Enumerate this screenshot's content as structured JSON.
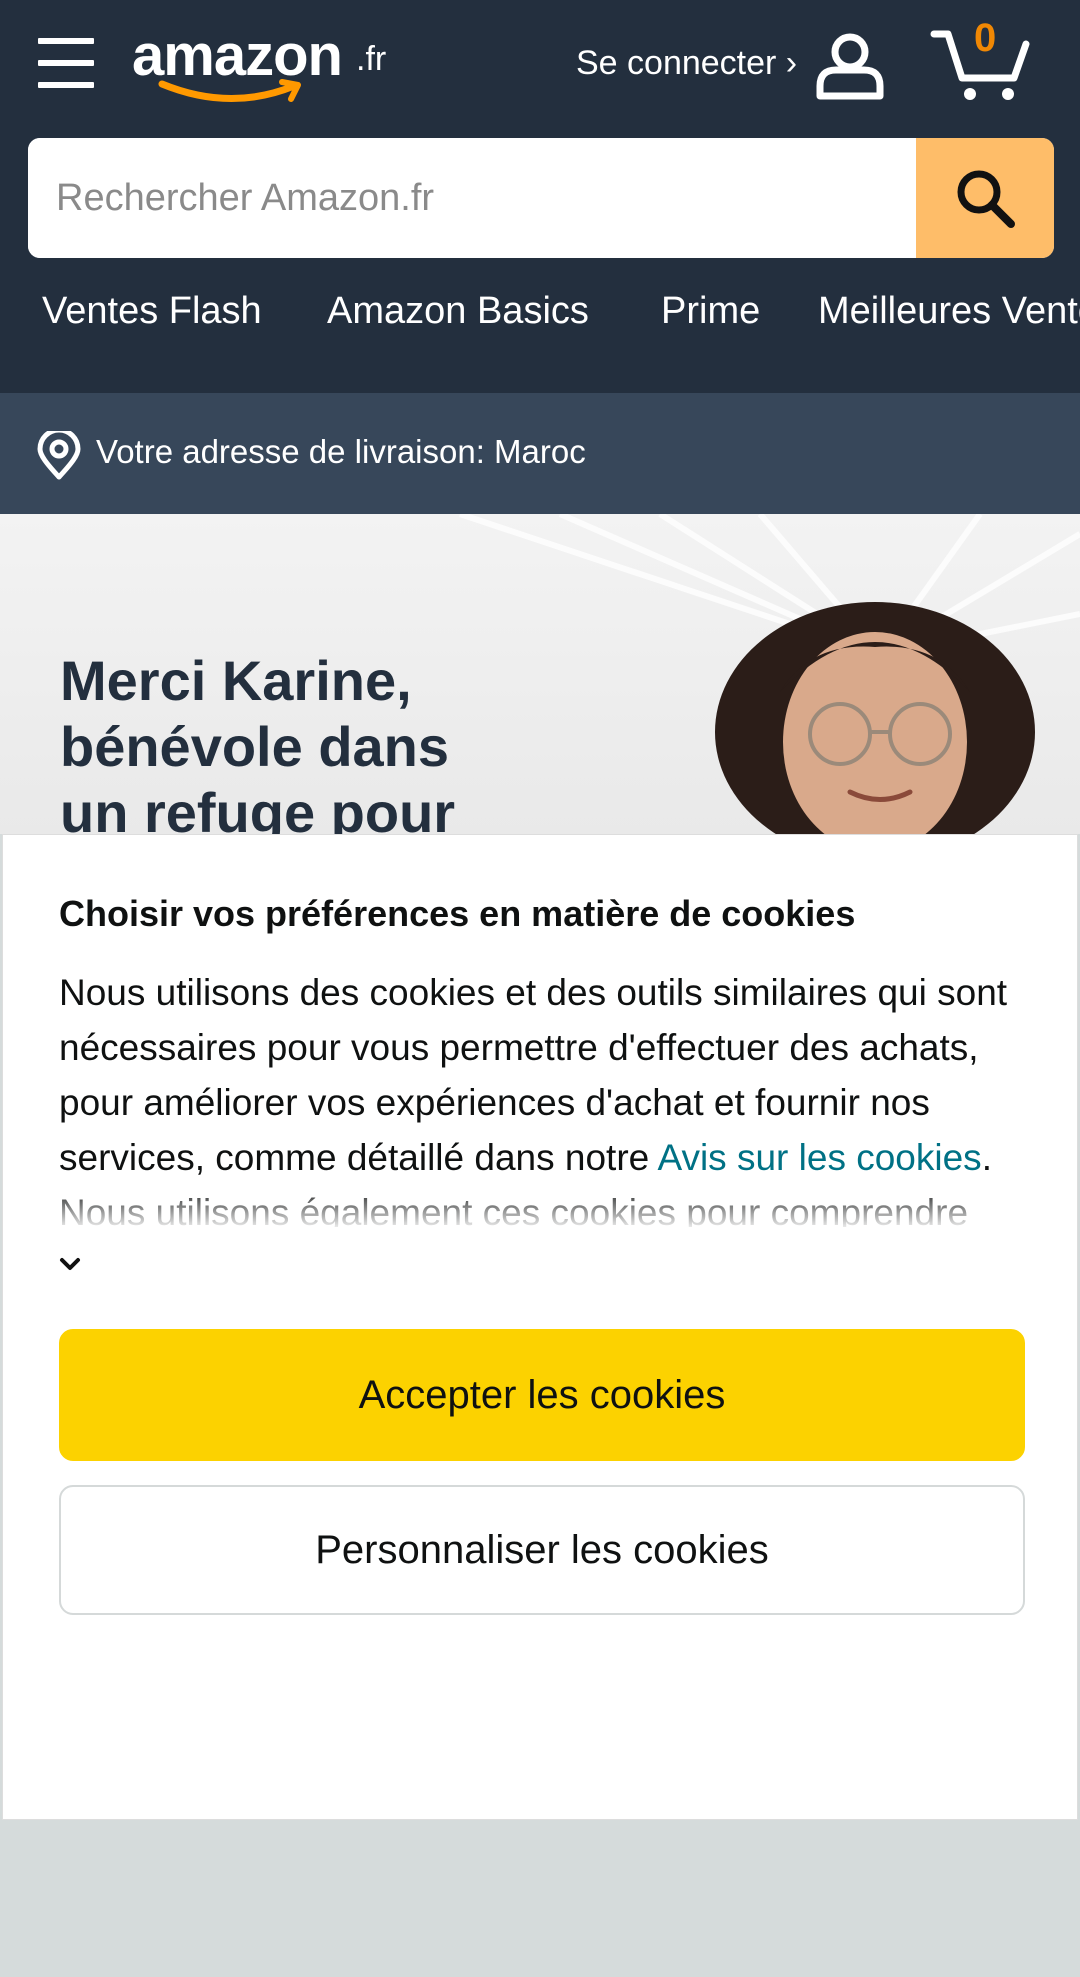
{
  "header": {
    "logo_word": "amazon",
    "logo_tld": ".fr",
    "signin_label": "Se connecter ›",
    "cart_count": "0",
    "search_placeholder": "Rechercher Amazon.fr",
    "colors": {
      "bar": "#232f3e",
      "search_button": "#febd69",
      "cart_count": "#f08804"
    },
    "icons": [
      "menu-icon",
      "user-icon",
      "cart-icon",
      "search-icon"
    ]
  },
  "nav": {
    "items": [
      "Ventes Flash",
      "Amazon Basics",
      "Prime",
      "Meilleures Ventes"
    ]
  },
  "address": {
    "text": "Votre adresse de livraison: Maroc",
    "icon": "location-pin-icon"
  },
  "hero": {
    "title": "Merci Karine, bénévole dans un refuge pour"
  },
  "cookie_panel": {
    "title": "Choisir vos préférences en matière de cookies",
    "body_before_link": "Nous utilisons des cookies et des outils similaires qui sont nécessaires pour vous permettre d'effectuer des achats, pour améliorer vos expériences d'achat et fournir nos services, comme détaillé dans notre ",
    "link_text": "Avis sur les cookies",
    "body_after_link": ". Nous utilisons également ces cookies pour comprendre comment les clients utilisent nos services (par exemple, en mesurant les visites sur le site) afin que nous puissions apporter",
    "accept_label": "Accepter les cookies",
    "customize_label": "Personnaliser les cookies",
    "colors": {
      "accept_button": "#fcd200",
      "link": "#007185"
    }
  }
}
